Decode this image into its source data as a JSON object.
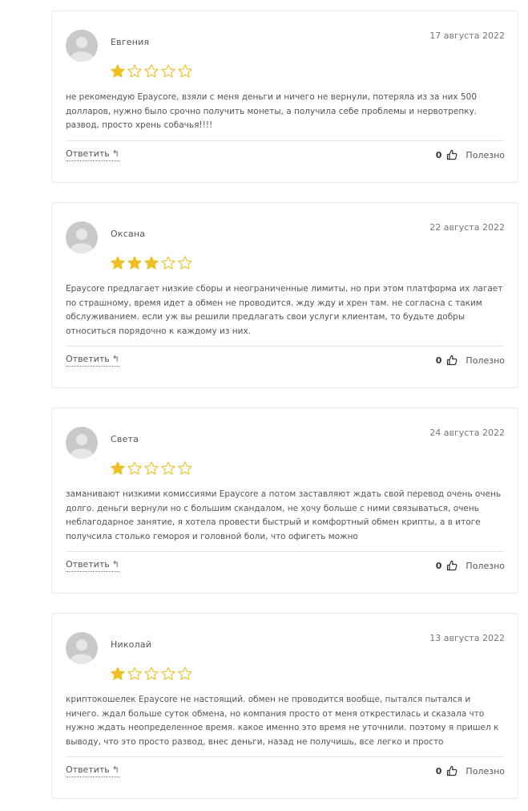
{
  "reviews": [
    {
      "author": "Евгения",
      "date": "17 августа 2022",
      "rating": 1,
      "text": "не рекомендую Epaycore, взяли с меня деньги и ничего не вернули, потеряла из за них 500 долларов, нужно было срочно получить монеты, а получила себе проблемы и нервотрепку. развод, просто хрень собачья!!!!",
      "reply_label": "Ответить",
      "likes": "0",
      "helpful_label": "Полезно"
    },
    {
      "author": "Оксана",
      "date": "22 августа 2022",
      "rating": 3,
      "text": "Epaycore предлагает низкие сборы и неограниченные лимиты, но при этом платформа их лагает по страшному, время идет а обмен не проводится. жду жду и хрен там. не согласна с таким обслуживанием. если уж вы решили предлагать свои услуги клиентам, то будьте добры относиться порядочно к каждому из них.",
      "reply_label": "Ответить",
      "likes": "0",
      "helpful_label": "Полезно"
    },
    {
      "author": "Света",
      "date": "24 августа 2022",
      "rating": 1,
      "text": "заманивают низкими комиссиями Epaycore а потом заставляют ждать свой перевод очень очень долго. деньги вернули но с большим скандалом, не хочу больше с ними связываться, очень неблагодарное занятие, я хотела провести быстрый и комфортный обмен крипты, а в итоге получсила столько гемороя и головной боли, что офигеть можно",
      "reply_label": "Ответить",
      "likes": "0",
      "helpful_label": "Полезно"
    },
    {
      "author": "Николай",
      "date": "13 августа 2022",
      "rating": 1,
      "text": "криптокошелек Epaycore не настоящий. обмен не проводится вообще, пытался пытался и ничего. ждал больше суток обмена, но компания просто от меня открестилась и сказала что нужно ждать неопределенное время. какое именно это время не уточнили. поэтому я пришел к выводу, что это просто развод, внес деньги, назад не получишь, все легко и просто",
      "reply_label": "Ответить",
      "likes": "0",
      "helpful_label": "Полезно"
    }
  ],
  "colors": {
    "star_filled": "#f2c01e",
    "star_empty": "#f2c01e",
    "avatar_bg": "#c9c9c9"
  },
  "icons": {
    "avatar": "user-avatar-icon",
    "reply": "reply-arrow-icon",
    "like": "thumbs-up-icon",
    "star": "star-icon"
  }
}
